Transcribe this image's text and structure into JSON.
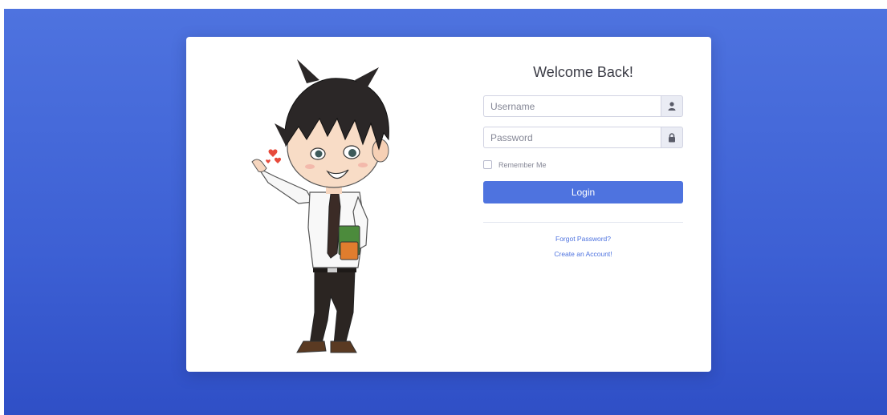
{
  "login": {
    "title": "Welcome Back!",
    "username": {
      "placeholder": "Username",
      "value": ""
    },
    "password": {
      "placeholder": "Password",
      "value": ""
    },
    "remember_label": "Remember Me",
    "remember_checked": false,
    "login_button": "Login",
    "forgot_password_link": "Forgot Password?",
    "create_account_link": "Create an Account!"
  },
  "icons": {
    "username": "user-icon",
    "password": "lock-icon"
  },
  "colors": {
    "primary": "#4e73df",
    "background_top": "#4e73df",
    "background_bottom": "#2f4fc6",
    "card": "#ffffff",
    "addon": "#eaecf4",
    "title_text": "#3a3b45"
  }
}
